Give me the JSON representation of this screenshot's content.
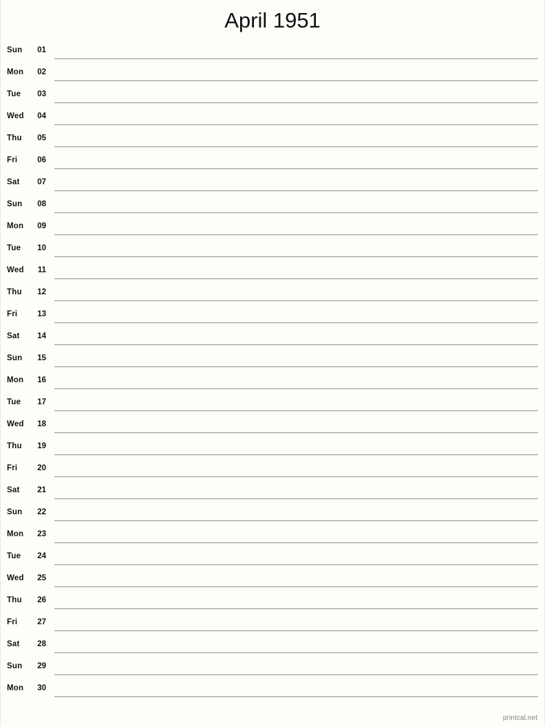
{
  "document": {
    "title": "April 1951",
    "month": "April",
    "year": "1951"
  },
  "calendar": {
    "rows": [
      {
        "dow": "Sun",
        "day": "01"
      },
      {
        "dow": "Mon",
        "day": "02"
      },
      {
        "dow": "Tue",
        "day": "03"
      },
      {
        "dow": "Wed",
        "day": "04"
      },
      {
        "dow": "Thu",
        "day": "05"
      },
      {
        "dow": "Fri",
        "day": "06"
      },
      {
        "dow": "Sat",
        "day": "07"
      },
      {
        "dow": "Sun",
        "day": "08"
      },
      {
        "dow": "Mon",
        "day": "09"
      },
      {
        "dow": "Tue",
        "day": "10"
      },
      {
        "dow": "Wed",
        "day": "11"
      },
      {
        "dow": "Thu",
        "day": "12"
      },
      {
        "dow": "Fri",
        "day": "13"
      },
      {
        "dow": "Sat",
        "day": "14"
      },
      {
        "dow": "Sun",
        "day": "15"
      },
      {
        "dow": "Mon",
        "day": "16"
      },
      {
        "dow": "Tue",
        "day": "17"
      },
      {
        "dow": "Wed",
        "day": "18"
      },
      {
        "dow": "Thu",
        "day": "19"
      },
      {
        "dow": "Fri",
        "day": "20"
      },
      {
        "dow": "Sat",
        "day": "21"
      },
      {
        "dow": "Sun",
        "day": "22"
      },
      {
        "dow": "Mon",
        "day": "23"
      },
      {
        "dow": "Tue",
        "day": "24"
      },
      {
        "dow": "Wed",
        "day": "25"
      },
      {
        "dow": "Thu",
        "day": "26"
      },
      {
        "dow": "Fri",
        "day": "27"
      },
      {
        "dow": "Sat",
        "day": "28"
      },
      {
        "dow": "Sun",
        "day": "29"
      },
      {
        "dow": "Mon",
        "day": "30"
      }
    ]
  },
  "footer": {
    "credit": "printcal.net"
  },
  "colors": {
    "background": "#fdfdfa",
    "text": "#111111",
    "rule": "#8c8c8c",
    "footer_text": "#7d7d7d"
  }
}
